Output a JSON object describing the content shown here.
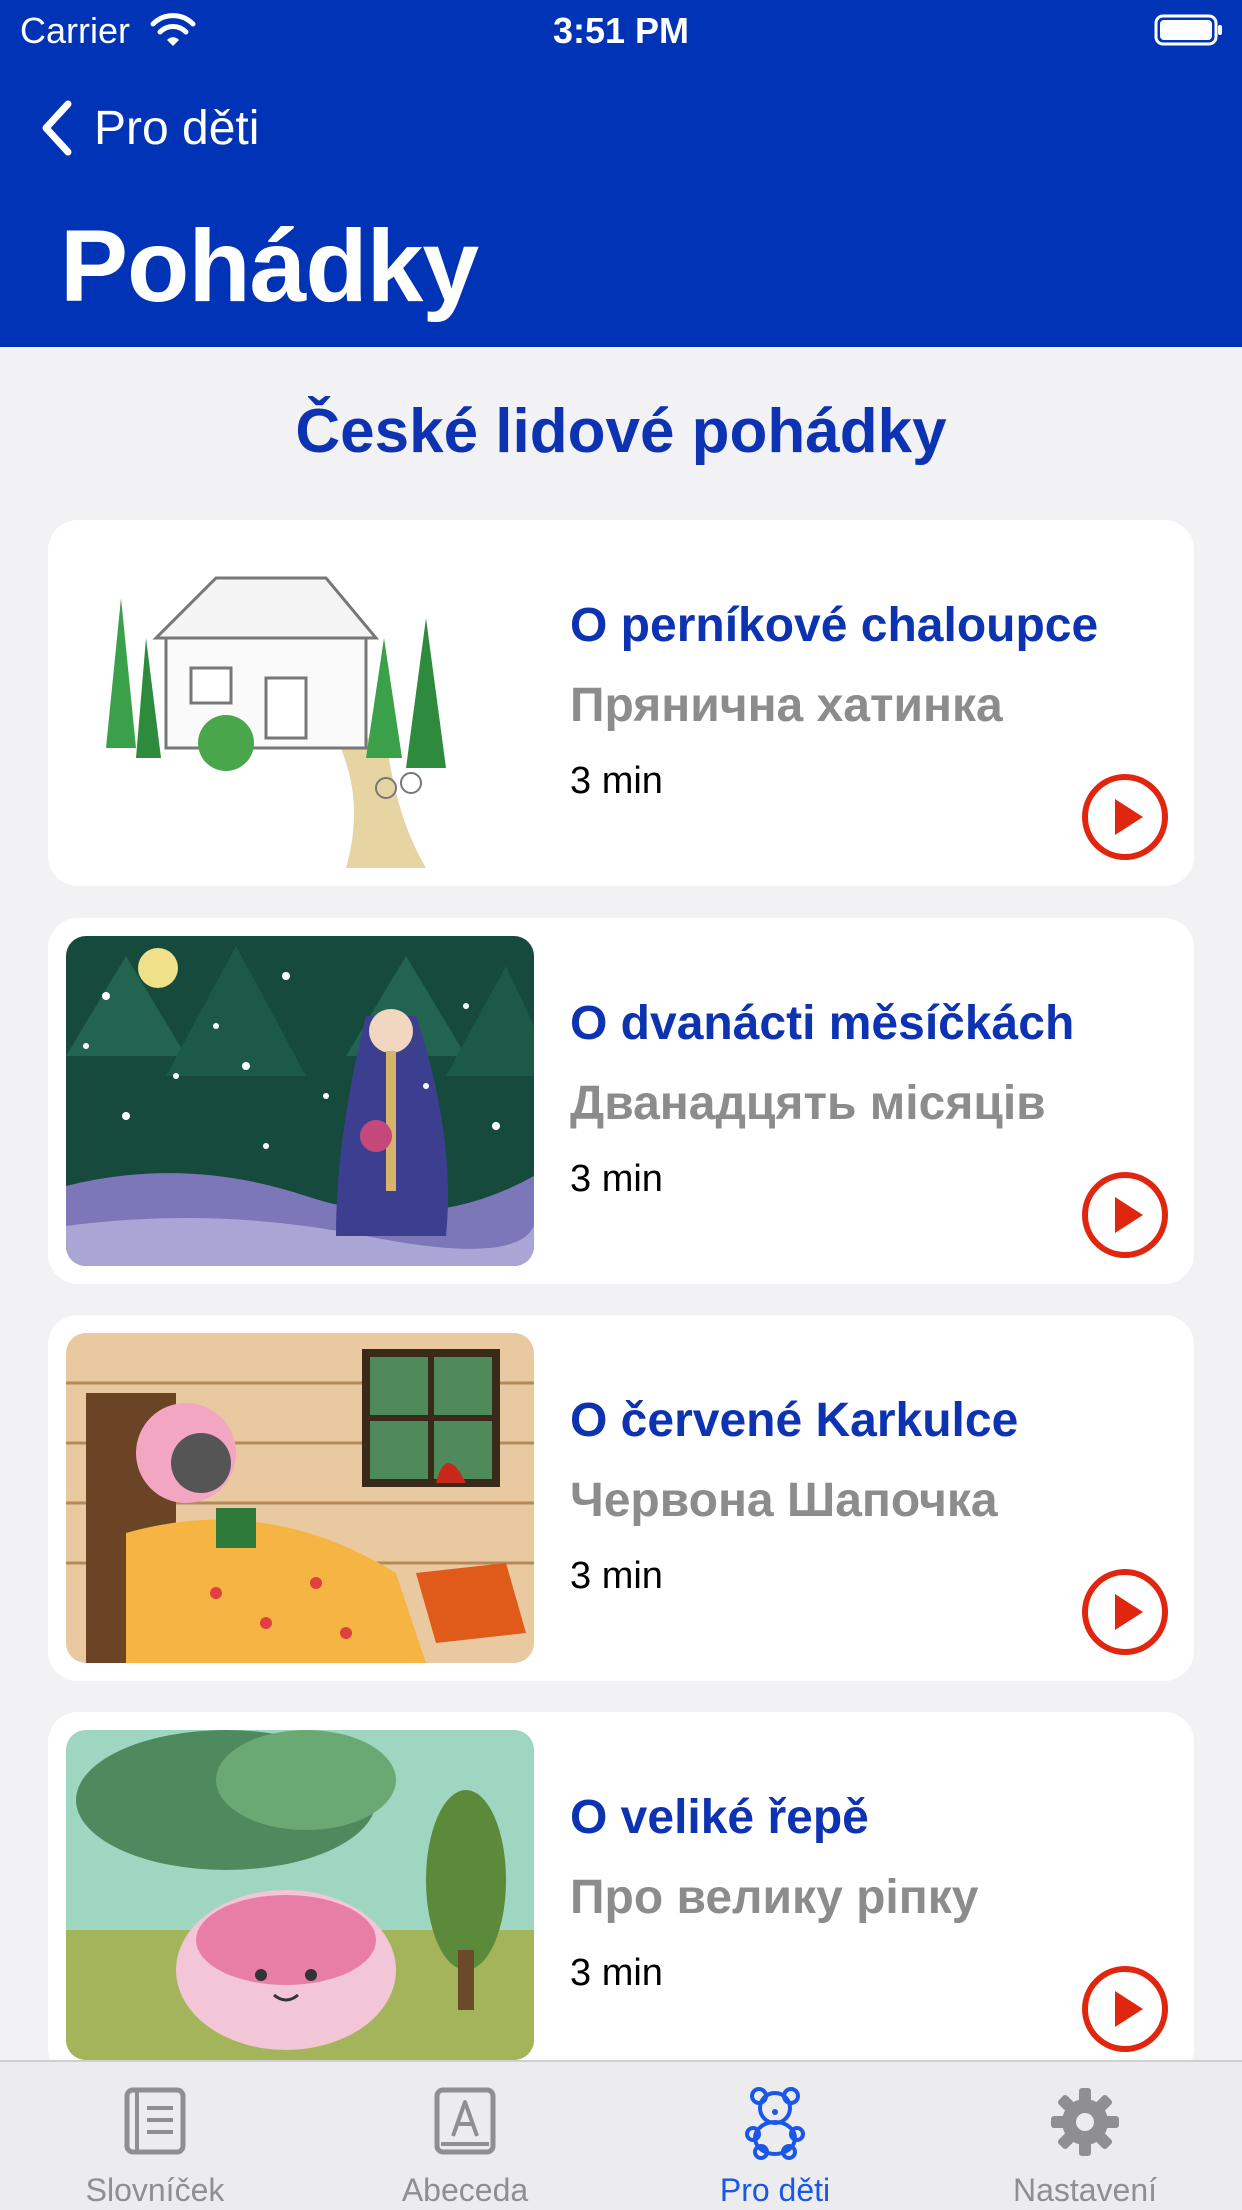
{
  "status_bar": {
    "carrier": "Carrier",
    "time": "3:51 PM"
  },
  "nav": {
    "back_label": "Pro děti",
    "title": "Pohádky"
  },
  "section": {
    "title": "České lidové pohádky"
  },
  "stories": [
    {
      "title": "O perníkové chaloupce",
      "subtitle": "Прянична хатинка",
      "duration": "3 min",
      "image": "gingerbread-house-illustration"
    },
    {
      "title": "O dvanácti měsíčkách",
      "subtitle": "Дванадцять місяців",
      "duration": "3 min",
      "image": "twelve-months-snow-illustration"
    },
    {
      "title": "O červené Karkulce",
      "subtitle": "Червона Шапочка",
      "duration": "3 min",
      "image": "little-red-riding-hood-illustration"
    },
    {
      "title": "O veliké řepě",
      "subtitle": "Про велику ріпку",
      "duration": "3 min",
      "image": "giant-turnip-illustration"
    }
  ],
  "tabs": [
    {
      "label": "Slovníček",
      "icon": "book-icon",
      "active": false
    },
    {
      "label": "Abeceda",
      "icon": "alphabet-book-icon",
      "active": false
    },
    {
      "label": "Pro děti",
      "icon": "teddy-bear-icon",
      "active": true
    },
    {
      "label": "Nastavení",
      "icon": "gear-icon",
      "active": false
    }
  ],
  "colors": {
    "header": "#0033b5",
    "accent": "#0d33b3",
    "play": "#e0260e",
    "tab_active": "#1a56e8"
  }
}
